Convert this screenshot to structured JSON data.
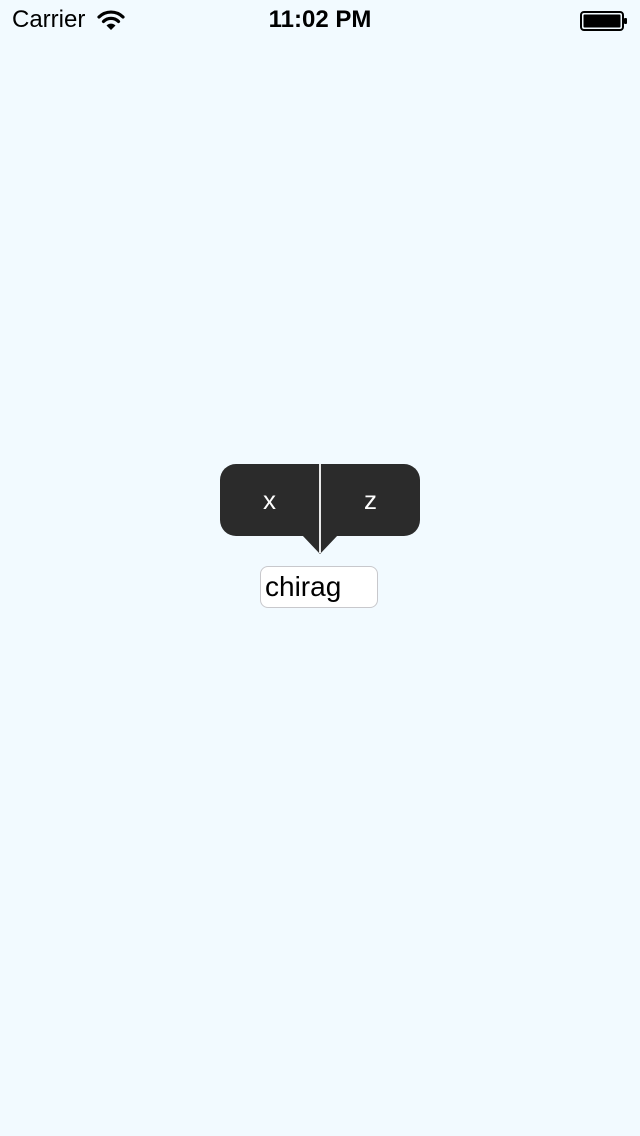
{
  "status_bar": {
    "carrier": "Carrier",
    "time": "11:02 PM",
    "wifi_icon": "wifi-icon",
    "battery_icon": "battery-full-icon"
  },
  "edit_menu": {
    "items": [
      {
        "label": "x"
      },
      {
        "label": "z"
      }
    ]
  },
  "text_field": {
    "value": "chirag"
  },
  "colors": {
    "background": "#f2faff",
    "menu_background": "#2b2b2b",
    "menu_text": "#ffffff"
  }
}
